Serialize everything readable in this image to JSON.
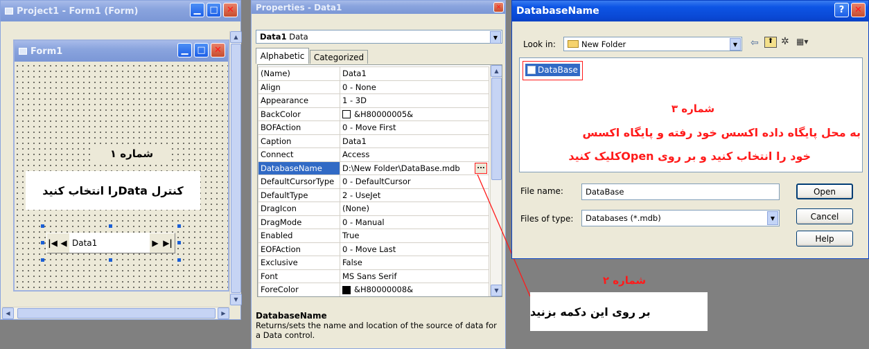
{
  "project_window": {
    "title": "Project1 - Form1 (Form)"
  },
  "form": {
    "title": "Form1",
    "label_step1": "شماره ۱",
    "instruction_line1": "کنترل Dataرا انتخاب کنید",
    "data_control_caption": "Data1",
    "nav_first": "|◀",
    "nav_prev": "◀",
    "nav_next": "▶",
    "nav_last": "▶|"
  },
  "properties_window": {
    "title": "Properties - Data1",
    "object_name": "Data1",
    "object_type": "Data",
    "tabs": [
      "Alphabetic",
      "Categorized"
    ],
    "rows": [
      {
        "name": "(Name)",
        "value": "Data1"
      },
      {
        "name": "Align",
        "value": "0 - None"
      },
      {
        "name": "Appearance",
        "value": "1 - 3D"
      },
      {
        "name": "BackColor",
        "value": "&H80000005&",
        "swatch": "#ffffff"
      },
      {
        "name": "BOFAction",
        "value": "0 - Move First"
      },
      {
        "name": "Caption",
        "value": "Data1"
      },
      {
        "name": "Connect",
        "value": "Access"
      },
      {
        "name": "DatabaseName",
        "value": "D:\\New Folder\\DataBase.mdb",
        "selected": true,
        "ellipsis": "..."
      },
      {
        "name": "DefaultCursorType",
        "value": "0 - DefaultCursor"
      },
      {
        "name": "DefaultType",
        "value": "2 - UseJet"
      },
      {
        "name": "DragIcon",
        "value": "(None)"
      },
      {
        "name": "DragMode",
        "value": "0 - Manual"
      },
      {
        "name": "Enabled",
        "value": "True"
      },
      {
        "name": "EOFAction",
        "value": "0 - Move Last"
      },
      {
        "name": "Exclusive",
        "value": "False"
      },
      {
        "name": "Font",
        "value": "MS Sans Serif"
      },
      {
        "name": "ForeColor",
        "value": "&H80000008&",
        "swatch": "#000000"
      }
    ],
    "description_title": "DatabaseName",
    "description_text": "Returns/sets the name and location of the source of data for a Data control."
  },
  "step2": {
    "label": "شماره ۲",
    "text": "بر روی این دکمه بزنید"
  },
  "dialog": {
    "title": "DatabaseName",
    "help_glyph": "?",
    "close_glyph": "✕",
    "look_in_label": "Look in:",
    "look_in_value": "New Folder",
    "file_item": "DataBase",
    "step3_label": "شماره ۳",
    "step3_line1": "به محل پایگاه داده اکسس خود رفته و پایگاه اکسس",
    "step3_line2": "خود را انتخاب کنید و بر روی Openکلیک کنید",
    "file_name_label": "File name:",
    "file_name_value": "DataBase",
    "files_of_type_label": "Files of type:",
    "files_of_type_value": "Databases (*.mdb)",
    "open_button": "Open",
    "cancel_button": "Cancel",
    "help_button": "Help"
  },
  "colors": {
    "annotation_red": "#ff1a1a",
    "selection_blue": "#316ac5",
    "xp_title_blue": "#0a48d4"
  }
}
